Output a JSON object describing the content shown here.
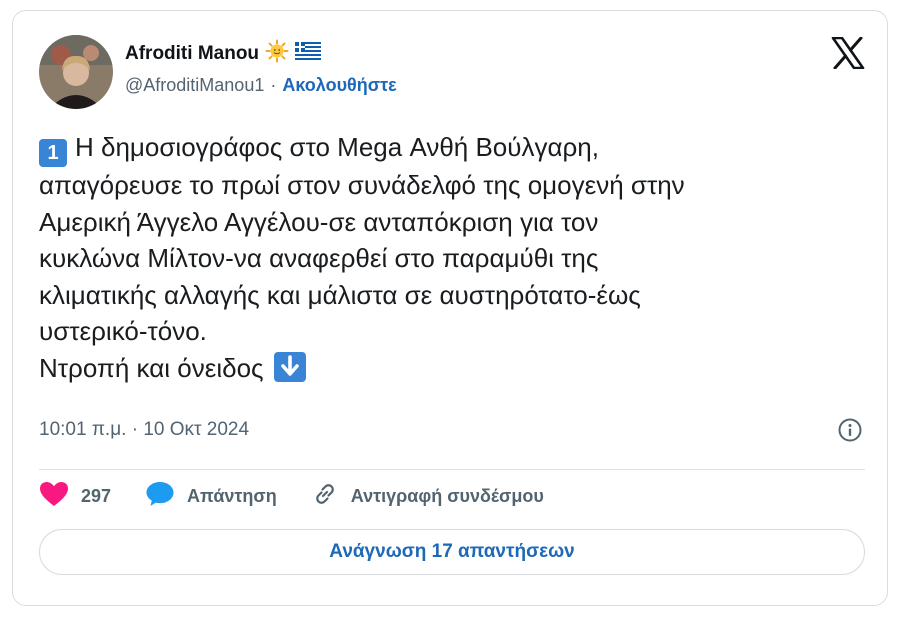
{
  "author": {
    "display_name": "Afroditi Manou",
    "handle": "@AfroditiManou1",
    "separator": "·",
    "follow_label": "Ακολουθήστε"
  },
  "icons": {
    "sun": "sun-emoji-icon",
    "flag": "greek-flag-icon",
    "logo": "x-logo-icon",
    "info": "info-icon",
    "like": "heart-icon",
    "reply": "speech-bubble-icon",
    "copy": "link-icon",
    "keycap": "keycap-1-icon",
    "arrow": "down-arrow-icon"
  },
  "tweet": {
    "keycap_label": "1",
    "text": "Η δημοσιογράφος στο Mega Ανθή Βούλγαρη,\nαπαγόρευσε το πρωί στον συνάδελφό της ομογενή στην\nΑμερική Άγγελο Αγγέλου-σε ανταπόκριση για τον\nκυκλώνα Μίλτον-να αναφερθεί στο παραμύθι της\nκλιματικής αλλαγής και μάλιστα σε αυστηρότατο-έως\nυστερικό-τόνο.\nΝτροπή και όνειδος",
    "timestamp": "10:01 π.μ. · 10 Οκτ 2024"
  },
  "actions": {
    "likes_count": "297",
    "reply_label": "Απάντηση",
    "copy_link_label": "Αντιγραφή συνδέσμου"
  },
  "read_replies_label": "Ανάγνωση 17 απαντήσεων",
  "colors": {
    "accent": "#1d68b8",
    "like": "#f91880",
    "reply": "#1d9bf0",
    "keycap": "#3a84d6",
    "muted": "#536471"
  }
}
